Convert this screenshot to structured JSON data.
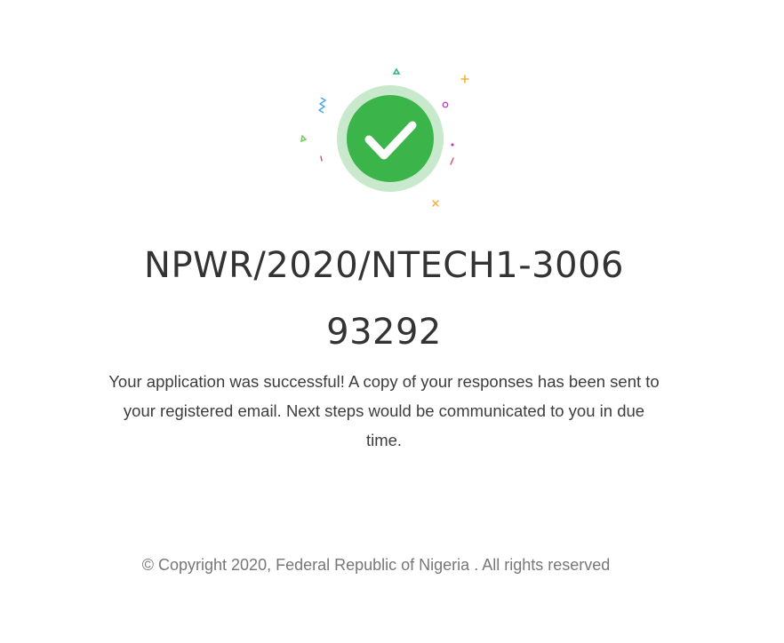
{
  "success": {
    "icon": "check-circle-icon",
    "colors": {
      "ring": "#c8e9cb",
      "fill": "#3bb54a",
      "check": "#ffffff"
    },
    "confetti": {
      "colors": [
        "#2fb673",
        "#f2b13a",
        "#4aa8e8",
        "#c23cc2",
        "#d64a6a",
        "#6bd05a"
      ]
    }
  },
  "reference_number": "NPWR/2020/NTECH1-300693292",
  "message": "Your application was successful! A copy of your responses has been sent to your registered email. Next steps would be communicated to you in due time.",
  "footer": {
    "copyright": "© Copyright 2020, Federal Republic of Nigeria . All rights reserved"
  }
}
